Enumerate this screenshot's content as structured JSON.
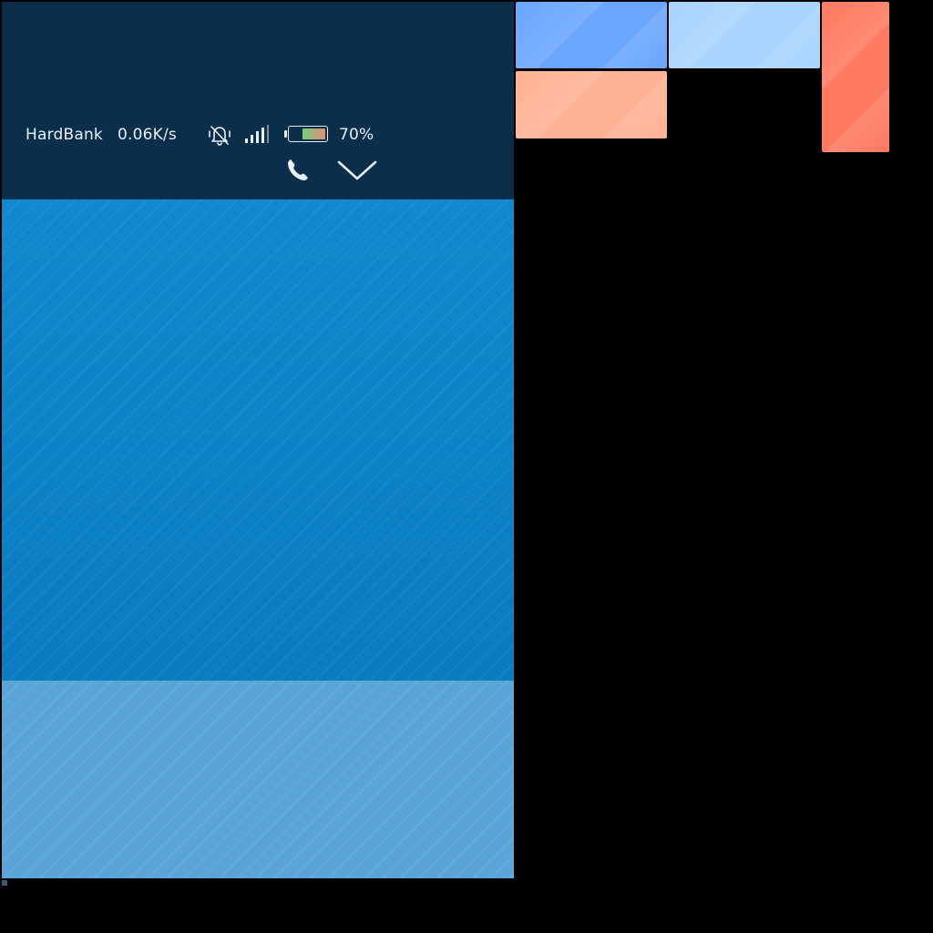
{
  "status_bar": {
    "carrier": "HardBank",
    "network_speed": "0.06K/s",
    "mute_icon": "vibrate-off-icon",
    "signal_icon": "signal-bars-icon",
    "signal_bars": 4,
    "battery_percent_label": "70%",
    "battery_level": 0.7
  },
  "actions": {
    "call_icon": "phone-icon",
    "expand_icon": "chevron-down-icon"
  },
  "colors": {
    "status_panel": "#0b2f4a",
    "band_top": "#0e7fc2",
    "band_bottom": "#5aa5d8",
    "tile_blue": "#6aa6ff",
    "tile_lightblue": "#a8d4ff",
    "tile_peach": "#ffb293",
    "tile_coral": "#ff7a60"
  }
}
